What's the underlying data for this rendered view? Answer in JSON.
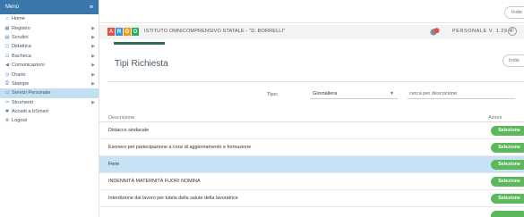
{
  "sidebar": {
    "header": "Menù",
    "header_icon": "hamburger-icon",
    "items": [
      {
        "label": "Home",
        "icon": "home-icon",
        "glyph": "⌂",
        "chevron": false,
        "active": false
      },
      {
        "label": "Registro",
        "icon": "calendar-icon",
        "glyph": "▦",
        "chevron": true,
        "active": false
      },
      {
        "label": "Scrutini",
        "icon": "document-icon",
        "glyph": "▤",
        "chevron": true,
        "active": false
      },
      {
        "label": "Didattica",
        "icon": "board-icon",
        "glyph": "◫",
        "chevron": true,
        "active": false
      },
      {
        "label": "Bacheca",
        "icon": "users-icon",
        "glyph": "☷",
        "chevron": true,
        "active": false
      },
      {
        "label": "Comunicazioni",
        "icon": "megaphone-icon",
        "glyph": "◀",
        "chevron": true,
        "active": false
      },
      {
        "label": "Orario",
        "icon": "clock-icon",
        "glyph": "◷",
        "chevron": true,
        "active": false
      },
      {
        "label": "Stampe",
        "icon": "print-icon",
        "glyph": "⎙",
        "chevron": true,
        "active": false
      },
      {
        "label": "Servizi Personale",
        "icon": "id-card-icon",
        "glyph": "▭",
        "chevron": false,
        "active": true
      },
      {
        "label": "Strumenti",
        "icon": "tools-icon",
        "glyph": "✂",
        "chevron": true,
        "active": false
      },
      {
        "label": "Accedi a bSmart",
        "icon": "star-icon",
        "glyph": "✱",
        "chevron": false,
        "active": false
      },
      {
        "label": "Logout",
        "icon": "logout-icon",
        "glyph": "⊗",
        "chevron": false,
        "active": false
      }
    ]
  },
  "topbar": {
    "button_label": "Indie"
  },
  "infobar": {
    "logo_letters": [
      "A",
      "R",
      "G",
      "O"
    ],
    "logo_colors": [
      "#e74c3c",
      "#3498db",
      "#f39c12",
      "#27ae60"
    ],
    "school_name": "ISTITUTO OMNICOMPRENSIVO STATALE - \"D. BORRELLI\"",
    "version": "PERSONALE V. 1.29.4",
    "help_glyph": "?"
  },
  "page": {
    "title": "Tipi Richiesta",
    "title_button_label": "Indie"
  },
  "filter": {
    "label": "Tipo:",
    "selected": "Giornaliera",
    "search_placeholder": "cerca per descrizione"
  },
  "table": {
    "header_description": "Descrizione",
    "header_actions": "Azioni",
    "action_label": "Selezione",
    "rows": [
      {
        "description": "Distacco sindacale",
        "highlight": false
      },
      {
        "description": "Esonero per partecipazione a corsi di aggiornamento e formazione",
        "highlight": false
      },
      {
        "description": "Ferie",
        "highlight": true
      },
      {
        "description": "INDENNITÀ MATERNITÀ FUORI NOMINA",
        "highlight": false
      },
      {
        "description": "Interdizione dal lavoro per tutela della salute della lavoratrice",
        "highlight": false
      }
    ]
  },
  "colors": {
    "sidebar_header": "#3a78ab",
    "active_row": "#c7e2f4",
    "action_button": "#5cb85c",
    "progress": "#2f6e55"
  }
}
